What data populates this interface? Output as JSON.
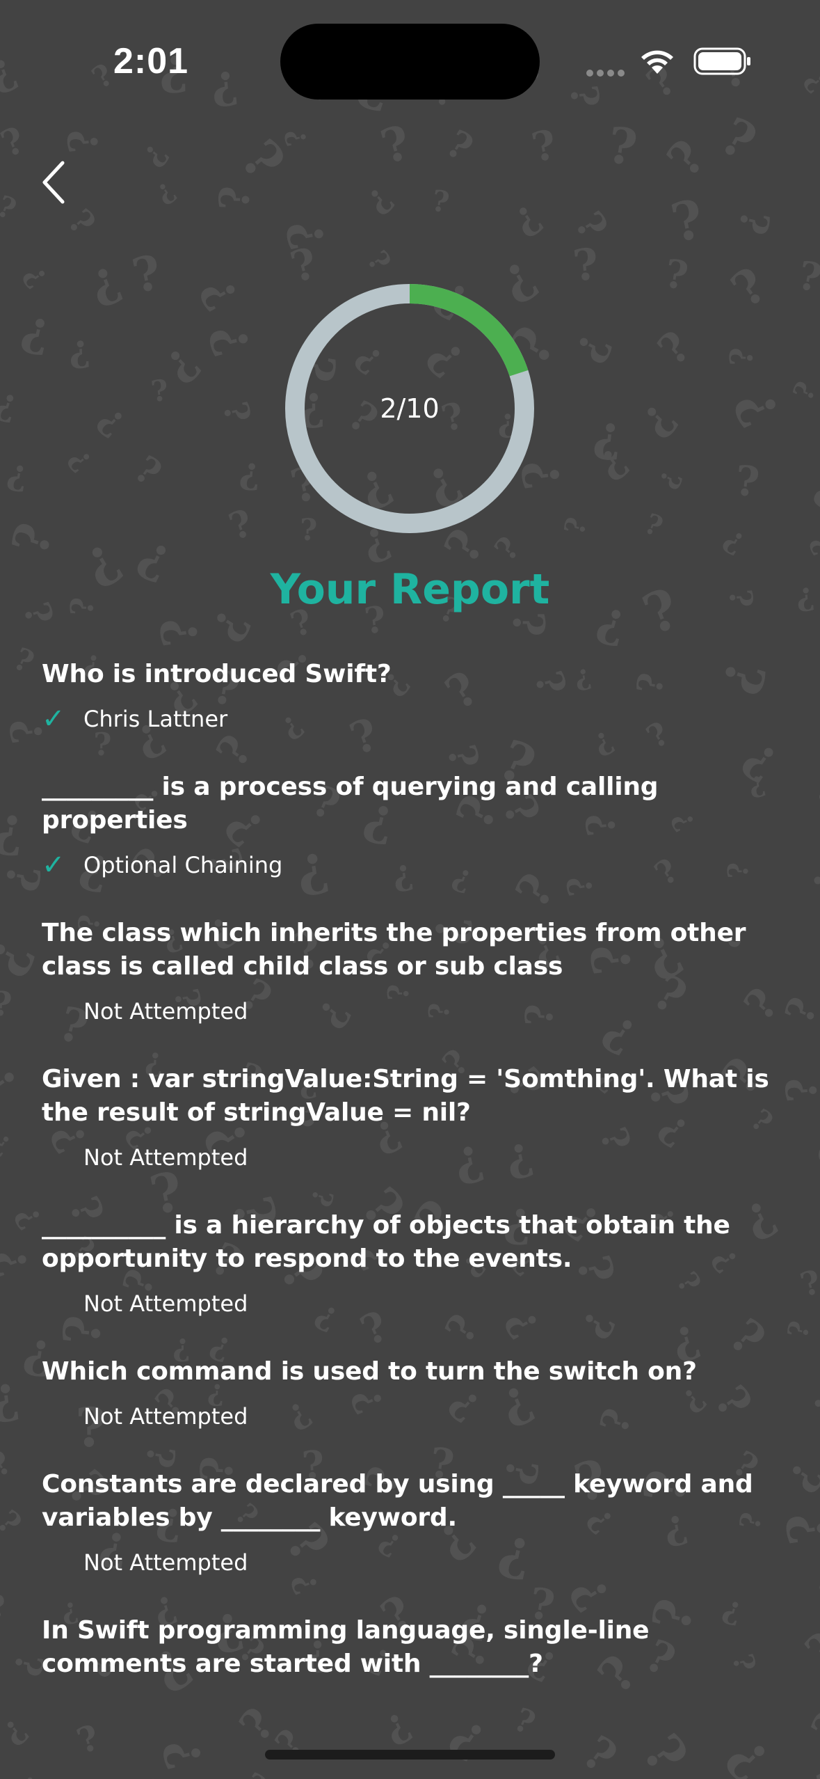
{
  "status_bar": {
    "time": "2:01"
  },
  "score": {
    "text": "2/10",
    "progress_fraction": 0.2,
    "track_color": "#b8c5ca",
    "progress_color": "#4caf50"
  },
  "report_title": "Your Report",
  "colors": {
    "accent": "#1fb3a0",
    "background": "#434343"
  },
  "questions": [
    {
      "question": "Who is introduced Swift?",
      "check": "✓",
      "answer": "Chris Lattner"
    },
    {
      "question": "_________ is a process of querying and calling properties",
      "check": "✓",
      "answer": "Optional Chaining"
    },
    {
      "question": "The class which inherits the properties from other class is called child class or sub class",
      "check": "",
      "answer": "Not Attempted"
    },
    {
      "question": "Given : var stringValue:String = 'Somthing'. What is the result of stringValue = nil?",
      "check": "",
      "answer": "Not Attempted"
    },
    {
      "question": "__________ is a hierarchy of objects that obtain the opportunity to respond to the events.",
      "check": "",
      "answer": "Not Attempted"
    },
    {
      "question": "Which command is used to turn the switch on?",
      "check": "",
      "answer": "Not Attempted"
    },
    {
      "question": "Constants are declared by using _____ keyword and variables by ________ keyword.",
      "check": "",
      "answer": "Not Attempted"
    },
    {
      "question": "In Swift programming language, single-line comments are started with ________?",
      "check": "",
      "answer": ""
    }
  ],
  "icons": {
    "back": "chevron-left-icon",
    "wifi": "wifi-icon",
    "battery": "battery-icon",
    "check": "checkmark-icon"
  }
}
